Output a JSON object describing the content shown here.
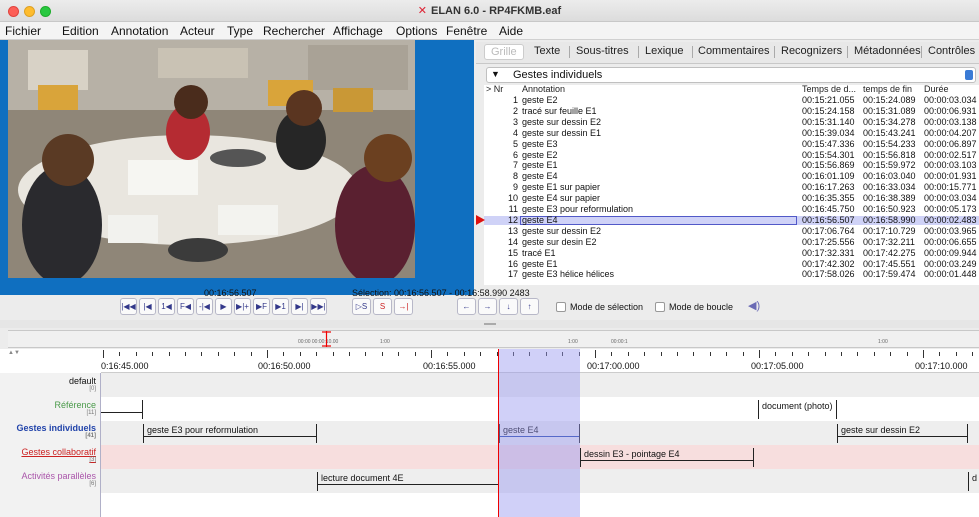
{
  "window": {
    "title": "ELAN 6.0 - RP4FKMB.eaf"
  },
  "menu": [
    "Fichier",
    "Edition",
    "Annotation",
    "Acteur",
    "Type",
    "Rechercher",
    "Affichage",
    "Options",
    "Fenêtre",
    "Aide"
  ],
  "tabs": [
    "Grille",
    "Texte",
    "Sous-titres",
    "Lexique",
    "Commentaires",
    "Recognizers",
    "Métadonnées",
    "Contrôles"
  ],
  "tier_selector": {
    "value": "Gestes individuels"
  },
  "grid": {
    "headers": {
      "nr": "> Nr",
      "annotation": "Annotation",
      "start": "Temps de d...",
      "end": "temps de fin",
      "duration": "Durée"
    },
    "rows": [
      {
        "nr": "1",
        "annotation": "geste E2",
        "start": "00:15:21.055",
        "end": "00:15:24.089",
        "duration": "00:00:03.034"
      },
      {
        "nr": "2",
        "annotation": "tracé sur feuille E1",
        "start": "00:15:24.158",
        "end": "00:15:31.089",
        "duration": "00:00:06.931"
      },
      {
        "nr": "3",
        "annotation": "geste sur dessin E2",
        "start": "00:15:31.140",
        "end": "00:15:34.278",
        "duration": "00:00:03.138"
      },
      {
        "nr": "4",
        "annotation": "geste sur dessin E1",
        "start": "00:15:39.034",
        "end": "00:15:43.241",
        "duration": "00:00:04.207"
      },
      {
        "nr": "5",
        "annotation": "geste E3",
        "start": "00:15:47.336",
        "end": "00:15:54.233",
        "duration": "00:00:06.897"
      },
      {
        "nr": "6",
        "annotation": "geste E2",
        "start": "00:15:54.301",
        "end": "00:15:56.818",
        "duration": "00:00:02.517"
      },
      {
        "nr": "7",
        "annotation": "geste E1",
        "start": "00:15:56.869",
        "end": "00:15:59.972",
        "duration": "00:00:03.103"
      },
      {
        "nr": "8",
        "annotation": "geste E4",
        "start": "00:16:01.109",
        "end": "00:16:03.040",
        "duration": "00:00:01.931"
      },
      {
        "nr": "9",
        "annotation": "geste E1 sur papier",
        "start": "00:16:17.263",
        "end": "00:16:33.034",
        "duration": "00:00:15.771"
      },
      {
        "nr": "10",
        "annotation": "geste E4 sur papier",
        "start": "00:16:35.355",
        "end": "00:16:38.389",
        "duration": "00:00:03.034"
      },
      {
        "nr": "11",
        "annotation": "geste E3 pour reformulation",
        "start": "00:16:45.750",
        "end": "00:16:50.923",
        "duration": "00:00:05.173"
      },
      {
        "nr": "12",
        "annotation": "geste E4",
        "start": "00:16:56.507",
        "end": "00:16:58.990",
        "duration": "00:00:02.483"
      },
      {
        "nr": "13",
        "annotation": "geste sur dessin E2",
        "start": "00:17:06.764",
        "end": "00:17:10.729",
        "duration": "00:00:03.965"
      },
      {
        "nr": "14",
        "annotation": "geste sur desin E2",
        "start": "00:17:25.556",
        "end": "00:17:32.211",
        "duration": "00:00:06.655"
      },
      {
        "nr": "15",
        "annotation": "tracé E1",
        "start": "00:17:32.331",
        "end": "00:17:42.275",
        "duration": "00:00:09.944"
      },
      {
        "nr": "16",
        "annotation": "geste E1",
        "start": "00:17:42.302",
        "end": "00:17:45.551",
        "duration": "00:00:03.249"
      },
      {
        "nr": "17",
        "annotation": "geste E3 hélice hélices",
        "start": "00:17:58.026",
        "end": "00:17:59.474",
        "duration": "00:00:01.448"
      }
    ],
    "selected_row": 11
  },
  "controls": {
    "current_time": "00:16:56.507",
    "selection": "Sélection: 00:16:56.507 - 00:16:58.990  2483",
    "buttons": [
      "|◀◀",
      "|◀",
      "1◀",
      "F◀",
      "-|◀",
      "▶",
      "▶|+",
      "▶F",
      "▶1",
      "▶|",
      "▶▶|",
      "▷S",
      "S",
      "→|",
      "←",
      "→",
      "↓",
      "↑"
    ],
    "selection_mode": "Mode de sélection",
    "loop_mode": "Mode de boucle"
  },
  "overview": {
    "labels": [
      "00:00   00:00:10.00",
      "1:00",
      "1:00",
      "00:00:1",
      "1:00"
    ]
  },
  "timeline": {
    "ruler_labels": [
      "0:16:45.000",
      "00:16:50.000",
      "00:16:55.000",
      "00:17:00.000",
      "00:17:05.000",
      "00:17:10.000"
    ],
    "tiers": [
      {
        "name": "default",
        "count": "[0]",
        "color": "#333333"
      },
      {
        "name": "Référence",
        "count": "[11]",
        "color": "#4a9a4a"
      },
      {
        "name": "Gestes individuels",
        "count": "[41]",
        "color": "#2244aa"
      },
      {
        "name": "Gestes collaboratif",
        "count": "[3]",
        "color": "#cc2222"
      },
      {
        "name": "Activités parallèles",
        "count": "[6]",
        "color": "#aa55aa"
      }
    ],
    "annotations": {
      "reference": [
        "document (photo)"
      ],
      "gestes_individuels": [
        "geste E3 pour reformulation",
        "geste E4",
        "geste sur dessin E2"
      ],
      "gestes_collaboratif": [
        "dessin E3 - pointage E4"
      ],
      "activites_paralleles": [
        "lecture document 4E",
        "d"
      ]
    }
  },
  "colors": {
    "accent": "#3a7bd5",
    "video_background": "#0f6fc0",
    "selection_band": "#b8b8f0",
    "crosshair": "#ee0000",
    "selected_row": "#cfd2f7"
  }
}
